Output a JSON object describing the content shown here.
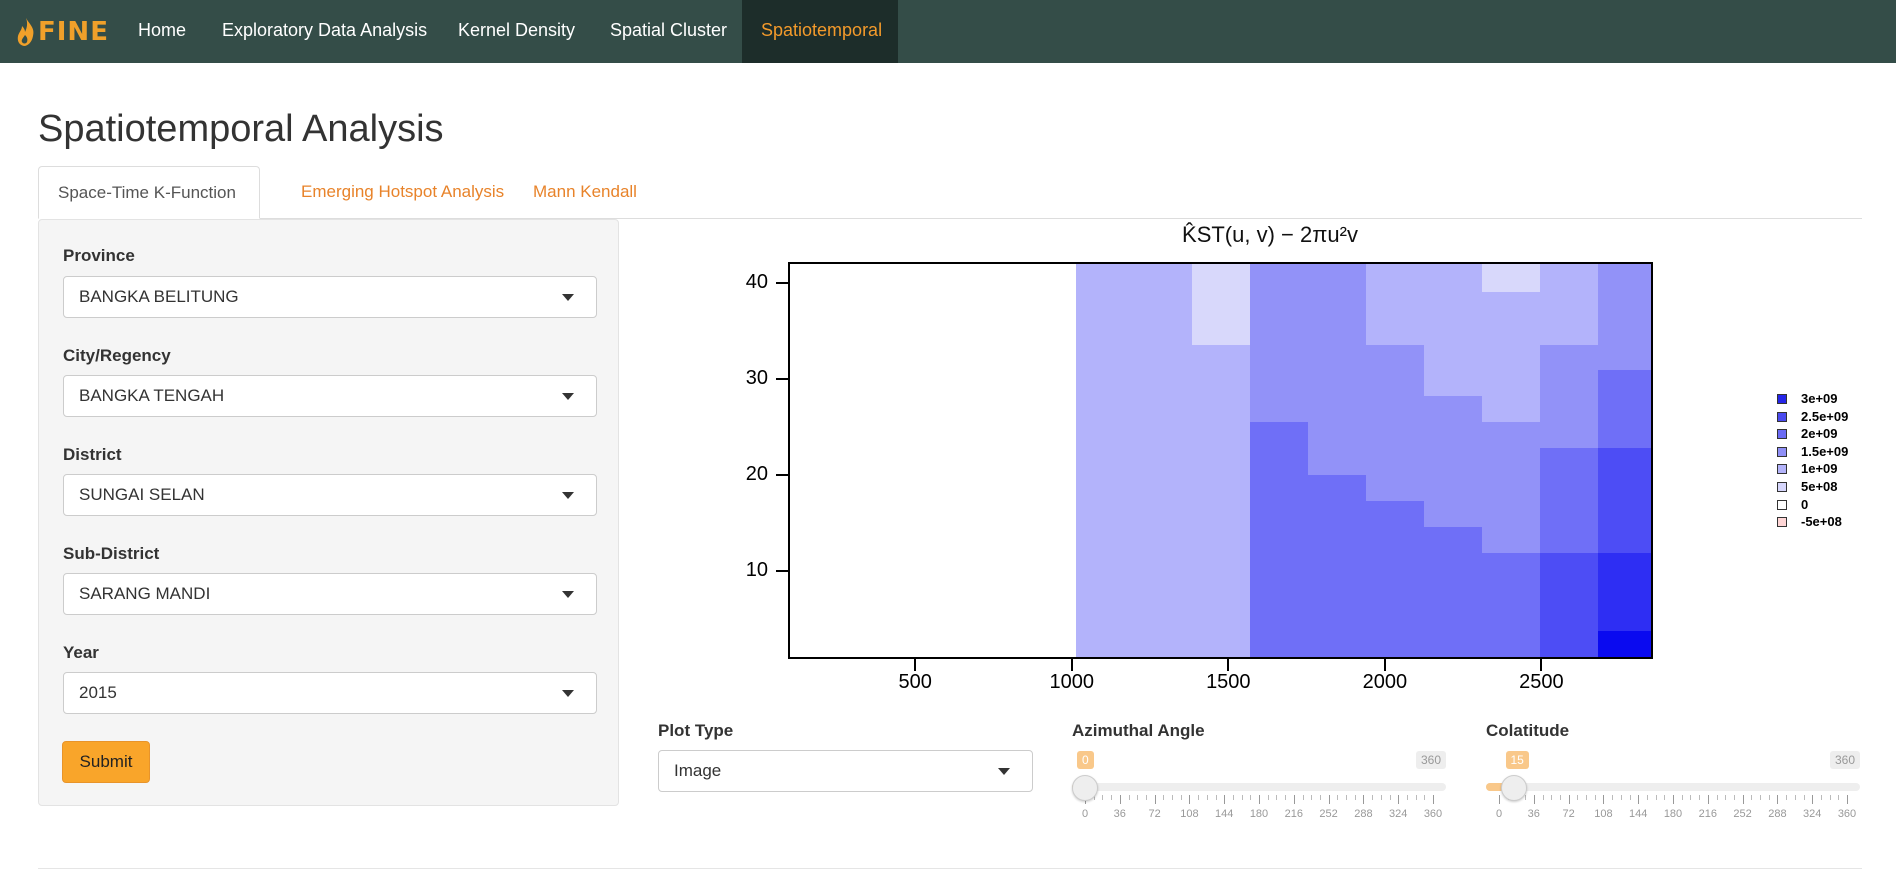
{
  "navbar": {
    "brand": "FINE",
    "items": [
      "Home",
      "Exploratory Data Analysis",
      "Kernel Density",
      "Spatial Cluster",
      "Spatiotemporal"
    ],
    "active_item": "Spatiotemporal"
  },
  "page": {
    "title": "Spatiotemporal Analysis"
  },
  "tabs": {
    "items": [
      "Space-Time K-Function",
      "Emerging Hotspot Analysis",
      "Mann Kendall"
    ],
    "active_tab": "Space-Time K-Function"
  },
  "form": {
    "fields": [
      {
        "label": "Province",
        "value": "BANGKA BELITUNG"
      },
      {
        "label": "City/Regency",
        "value": "BANGKA TENGAH"
      },
      {
        "label": "District",
        "value": "SUNGAI SELAN"
      },
      {
        "label": "Sub-District",
        "value": "SARANG MANDI"
      },
      {
        "label": "Year",
        "value": "2015"
      }
    ],
    "submit_label": "Submit"
  },
  "controls": {
    "plot_type": {
      "label": "Plot Type",
      "value": "Image"
    },
    "azimuthal": {
      "label": "Azimuthal Angle",
      "min": 0,
      "max": 360,
      "value": 0,
      "ticks": [
        "0",
        "36",
        "72",
        "108",
        "144",
        "180",
        "216",
        "252",
        "288",
        "324",
        "360"
      ]
    },
    "colatitude": {
      "label": "Colatitude",
      "min": 0,
      "max": 360,
      "value": 15,
      "ticks": [
        "0",
        "36",
        "72",
        "108",
        "144",
        "180",
        "216",
        "252",
        "288",
        "324",
        "360"
      ]
    }
  },
  "chart_data": {
    "type": "heatmap",
    "title": "K̂ST(u, v) − 2πu²v",
    "x_ticks": [
      "500",
      "1000",
      "1500",
      "2000",
      "2500"
    ],
    "y_ticks": [
      "10",
      "20",
      "30",
      "40"
    ],
    "xlim": [
      100,
      2850
    ],
    "ylim": [
      1,
      42
    ],
    "x_bins": [
      100,
      1015,
      1200,
      1385,
      1570,
      1755,
      1940,
      2125,
      2310,
      2495,
      2680,
      2850
    ],
    "y_bins": [
      1,
      3.7,
      6.4,
      9.2,
      11.9,
      14.6,
      17.3,
      20.0,
      22.8,
      25.5,
      28.2,
      30.9,
      33.6,
      36.4,
      39.1,
      42
    ],
    "values_rows_top_to_bottom": [
      [
        0,
        1000000000.0,
        1000000000.0,
        500000000.0,
        1500000000.0,
        1500000000.0,
        1000000000.0,
        1000000000.0,
        500000000.0,
        1000000000.0,
        1500000000.0
      ],
      [
        0,
        1000000000.0,
        1000000000.0,
        500000000.0,
        1500000000.0,
        1500000000.0,
        1000000000.0,
        1000000000.0,
        1000000000.0,
        1000000000.0,
        1500000000.0
      ],
      [
        0,
        1000000000.0,
        1000000000.0,
        500000000.0,
        1500000000.0,
        1500000000.0,
        1000000000.0,
        1000000000.0,
        1000000000.0,
        1000000000.0,
        1500000000.0
      ],
      [
        0,
        1000000000.0,
        1000000000.0,
        1000000000.0,
        1500000000.0,
        1500000000.0,
        1500000000.0,
        1000000000.0,
        1000000000.0,
        1500000000.0,
        1500000000.0
      ],
      [
        0,
        1000000000.0,
        1000000000.0,
        1000000000.0,
        1500000000.0,
        1500000000.0,
        1500000000.0,
        1000000000.0,
        1000000000.0,
        1500000000.0,
        2000000000.0
      ],
      [
        0,
        1000000000.0,
        1000000000.0,
        1000000000.0,
        1500000000.0,
        1500000000.0,
        1500000000.0,
        1500000000.0,
        1000000000.0,
        1500000000.0,
        2000000000.0
      ],
      [
        0,
        1000000000.0,
        1000000000.0,
        1000000000.0,
        2000000000.0,
        1500000000.0,
        1500000000.0,
        1500000000.0,
        1500000000.0,
        1500000000.0,
        2000000000.0
      ],
      [
        0,
        1000000000.0,
        1000000000.0,
        1000000000.0,
        2000000000.0,
        1500000000.0,
        1500000000.0,
        1500000000.0,
        1500000000.0,
        2000000000.0,
        2500000000.0
      ],
      [
        0,
        1000000000.0,
        1000000000.0,
        1000000000.0,
        2000000000.0,
        2000000000.0,
        1500000000.0,
        1500000000.0,
        1500000000.0,
        2000000000.0,
        2500000000.0
      ],
      [
        0,
        1000000000.0,
        1000000000.0,
        1000000000.0,
        2000000000.0,
        2000000000.0,
        2000000000.0,
        1500000000.0,
        1500000000.0,
        2000000000.0,
        2500000000.0
      ],
      [
        0,
        1000000000.0,
        1000000000.0,
        1000000000.0,
        2000000000.0,
        2000000000.0,
        2000000000.0,
        2000000000.0,
        1500000000.0,
        2000000000.0,
        2500000000.0
      ],
      [
        0,
        1000000000.0,
        1000000000.0,
        1000000000.0,
        2000000000.0,
        2000000000.0,
        2000000000.0,
        2000000000.0,
        2000000000.0,
        2500000000.0,
        3000000000.0
      ],
      [
        0,
        1000000000.0,
        1000000000.0,
        1000000000.0,
        2000000000.0,
        2000000000.0,
        2000000000.0,
        2000000000.0,
        2000000000.0,
        2500000000.0,
        3000000000.0
      ],
      [
        0,
        1000000000.0,
        1000000000.0,
        1000000000.0,
        2000000000.0,
        2000000000.0,
        2000000000.0,
        2000000000.0,
        2000000000.0,
        2500000000.0,
        3000000000.0
      ],
      [
        0,
        1000000000.0,
        1000000000.0,
        1000000000.0,
        2000000000.0,
        2000000000.0,
        2000000000.0,
        2000000000.0,
        2000000000.0,
        2500000000.0,
        3500000000.0
      ]
    ],
    "legend": [
      {
        "label": "3e+09",
        "color": "#2525e8"
      },
      {
        "label": "2.5e+09",
        "color": "#4a4aee"
      },
      {
        "label": "2e+09",
        "color": "#6b6bf4"
      },
      {
        "label": "1.5e+09",
        "color": "#8f8ff6"
      },
      {
        "label": "1e+09",
        "color": "#b3b3fa"
      },
      {
        "label": "5e+08",
        "color": "#d6d6fc"
      },
      {
        "label": "0",
        "color": "#ffffff"
      },
      {
        "label": "-5e+08",
        "color": "#ffd6d6"
      }
    ],
    "colors": {
      "0": "#ffffff",
      "5e8": "#d8d8fb",
      "1e9": "#b3b3fb",
      "1.5e9": "#9292f8",
      "2e9": "#6f6ff7",
      "2.5e9": "#4d4df5",
      "3e9": "#2e2ef3",
      "3.5e9": "#0a0af0"
    }
  }
}
